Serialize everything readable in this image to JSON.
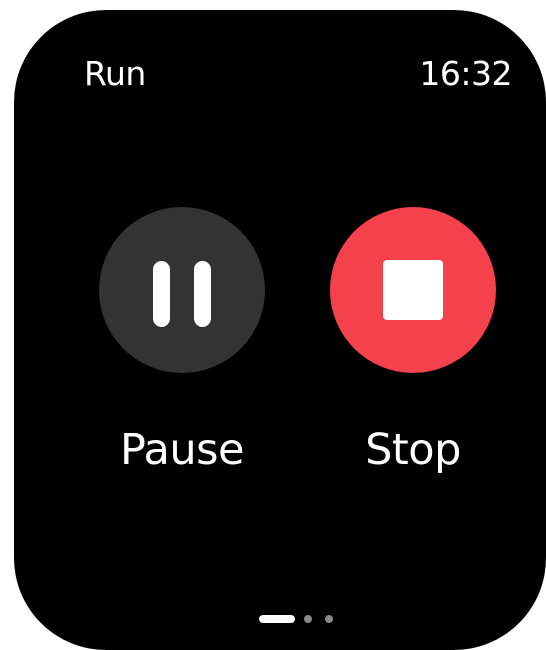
{
  "header": {
    "title": "Run",
    "time": "16:32"
  },
  "controls": [
    {
      "name": "pause",
      "label": "Pause",
      "icon": "pause-icon",
      "color": "#333333"
    },
    {
      "name": "stop",
      "label": "Stop",
      "icon": "stop-icon",
      "color": "#f4414b"
    }
  ],
  "page_indicator": {
    "total_pages": 3,
    "active_page": 1
  },
  "colors": {
    "background": "#000000",
    "text": "#ffffff",
    "pause_button": "#333333",
    "stop_button": "#f4414b",
    "indicator_active": "#ffffff",
    "indicator_inactive": "#8a8a8a"
  }
}
